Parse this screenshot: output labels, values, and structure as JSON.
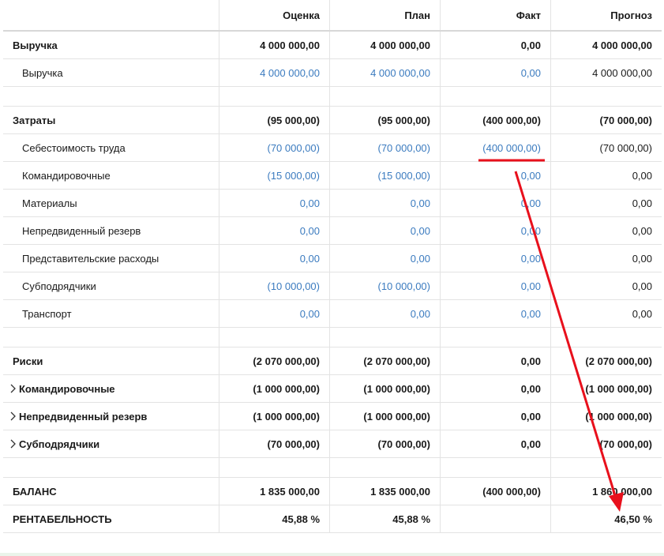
{
  "columns": [
    "",
    "Оценка",
    "План",
    "Факт",
    "Прогноз"
  ],
  "rows": [
    {
      "type": "group",
      "label": "Выручка",
      "values": [
        "4 000 000,00",
        "4 000 000,00",
        "0,00",
        "4 000 000,00"
      ],
      "links": [
        false,
        false,
        false,
        false
      ]
    },
    {
      "type": "item",
      "label": "Выручка",
      "values": [
        "4 000 000,00",
        "4 000 000,00",
        "0,00",
        "4 000 000,00"
      ],
      "links": [
        true,
        true,
        true,
        false
      ]
    },
    {
      "type": "spacer"
    },
    {
      "type": "group",
      "label": "Затраты",
      "values": [
        "(95 000,00)",
        "(95 000,00)",
        "(400 000,00)",
        "(70 000,00)"
      ],
      "links": [
        false,
        false,
        false,
        false
      ]
    },
    {
      "type": "item",
      "label": "Себестоимость труда",
      "values": [
        "(70 000,00)",
        "(70 000,00)",
        "(400 000,00)",
        "(70 000,00)"
      ],
      "links": [
        true,
        true,
        true,
        false
      ]
    },
    {
      "type": "item",
      "label": "Командировочные",
      "values": [
        "(15 000,00)",
        "(15 000,00)",
        "0,00",
        "0,00"
      ],
      "links": [
        true,
        true,
        true,
        false
      ]
    },
    {
      "type": "item",
      "label": "Материалы",
      "values": [
        "0,00",
        "0,00",
        "0,00",
        "0,00"
      ],
      "links": [
        true,
        true,
        true,
        false
      ]
    },
    {
      "type": "item",
      "label": "Непредвиденный резерв",
      "values": [
        "0,00",
        "0,00",
        "0,00",
        "0,00"
      ],
      "links": [
        true,
        true,
        true,
        false
      ]
    },
    {
      "type": "item",
      "label": "Представительские расходы",
      "values": [
        "0,00",
        "0,00",
        "0,00",
        "0,00"
      ],
      "links": [
        true,
        true,
        true,
        false
      ]
    },
    {
      "type": "item",
      "label": "Субподрядчики",
      "values": [
        "(10 000,00)",
        "(10 000,00)",
        "0,00",
        "0,00"
      ],
      "links": [
        true,
        true,
        true,
        false
      ]
    },
    {
      "type": "item",
      "label": "Транспорт",
      "values": [
        "0,00",
        "0,00",
        "0,00",
        "0,00"
      ],
      "links": [
        true,
        true,
        true,
        false
      ]
    },
    {
      "type": "spacer"
    },
    {
      "type": "group",
      "label": "Риски",
      "values": [
        "(2 070 000,00)",
        "(2 070 000,00)",
        "0,00",
        "(2 070 000,00)"
      ],
      "links": [
        false,
        false,
        false,
        false
      ]
    },
    {
      "type": "expand",
      "label": "Командировочные",
      "values": [
        "(1 000 000,00)",
        "(1 000 000,00)",
        "0,00",
        "(1 000 000,00)"
      ],
      "links": [
        false,
        false,
        false,
        false
      ]
    },
    {
      "type": "expand",
      "label": "Непредвиденный резерв",
      "values": [
        "(1 000 000,00)",
        "(1 000 000,00)",
        "0,00",
        "(1 000 000,00)"
      ],
      "links": [
        false,
        false,
        false,
        false
      ]
    },
    {
      "type": "expand",
      "label": "Субподрядчики",
      "values": [
        "(70 000,00)",
        "(70 000,00)",
        "0,00",
        "(70 000,00)"
      ],
      "links": [
        false,
        false,
        false,
        false
      ]
    },
    {
      "type": "spacer"
    },
    {
      "type": "group",
      "label": "БАЛАНС",
      "values": [
        "1 835 000,00",
        "1 835 000,00",
        "(400 000,00)",
        "1 860 000,00"
      ],
      "links": [
        false,
        false,
        false,
        false
      ]
    },
    {
      "type": "group",
      "label": "РЕНТАБЕЛЬНОСТЬ",
      "values": [
        "45,88 %",
        "45,88 %",
        "",
        "46,50 %"
      ],
      "links": [
        false,
        false,
        false,
        false
      ]
    }
  ],
  "annotation": {
    "color": "#e8101c"
  }
}
